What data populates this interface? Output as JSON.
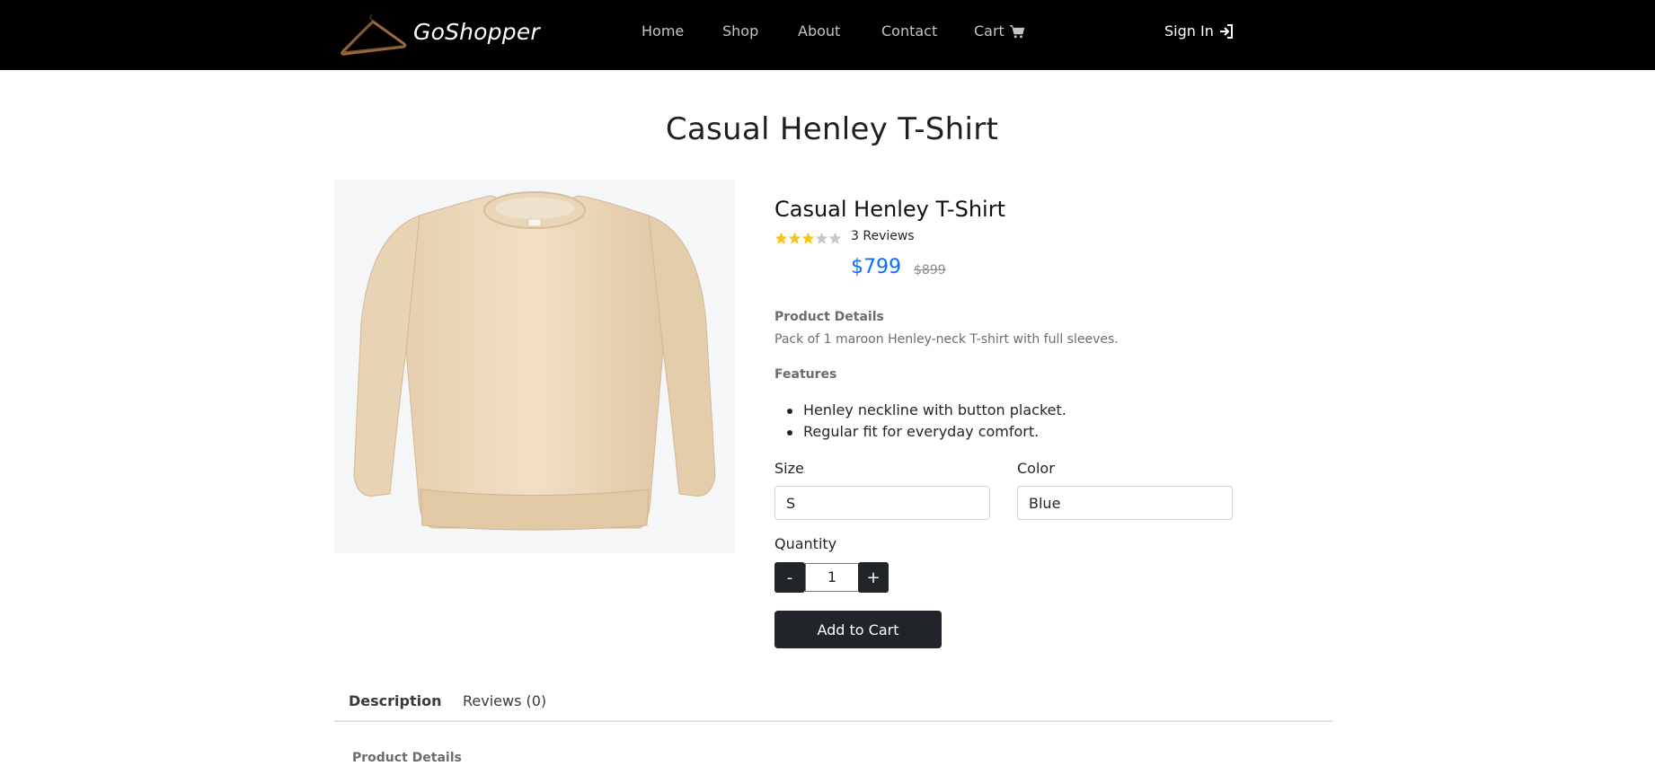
{
  "brand": {
    "name": "GoShopper",
    "logo_icon": "hanger-icon"
  },
  "nav": {
    "links": [
      "Home",
      "Shop",
      "About",
      "Contact"
    ],
    "cart_label": "Cart",
    "cart_icon": "cart-icon",
    "signin_label": "Sign In",
    "signin_icon": "sign-in-icon"
  },
  "page_title": "Casual Henley T-Shirt",
  "product": {
    "image_alt": "beige-sweatshirt-image",
    "name": "Casual Henley T-Shirt",
    "rating": 3,
    "rating_max": 5,
    "reviews_label": "3 Reviews",
    "price": "$799",
    "old_price": "$899",
    "details_heading": "Product Details",
    "details_text": "Pack of 1 maroon Henley-neck T-shirt with full sleeves.",
    "features_heading": "Features",
    "features": [
      "Henley neckline with button placket.",
      "Regular fit for everyday comfort."
    ],
    "size_label": "Size",
    "size_value": "S",
    "color_label": "Color",
    "color_value": "Blue",
    "quantity_label": "Quantity",
    "quantity_value": "1",
    "minus_label": "-",
    "plus_label": "+",
    "add_to_cart_label": "Add to Cart"
  },
  "tabs": {
    "description": "Description",
    "reviews": "Reviews (0)",
    "content_heading": "Product Details"
  },
  "colors": {
    "navbar": "#000000",
    "price": "#0d6efd",
    "star_filled": "#f5c518",
    "star_empty": "#c8c8c8",
    "button": "#212529"
  }
}
